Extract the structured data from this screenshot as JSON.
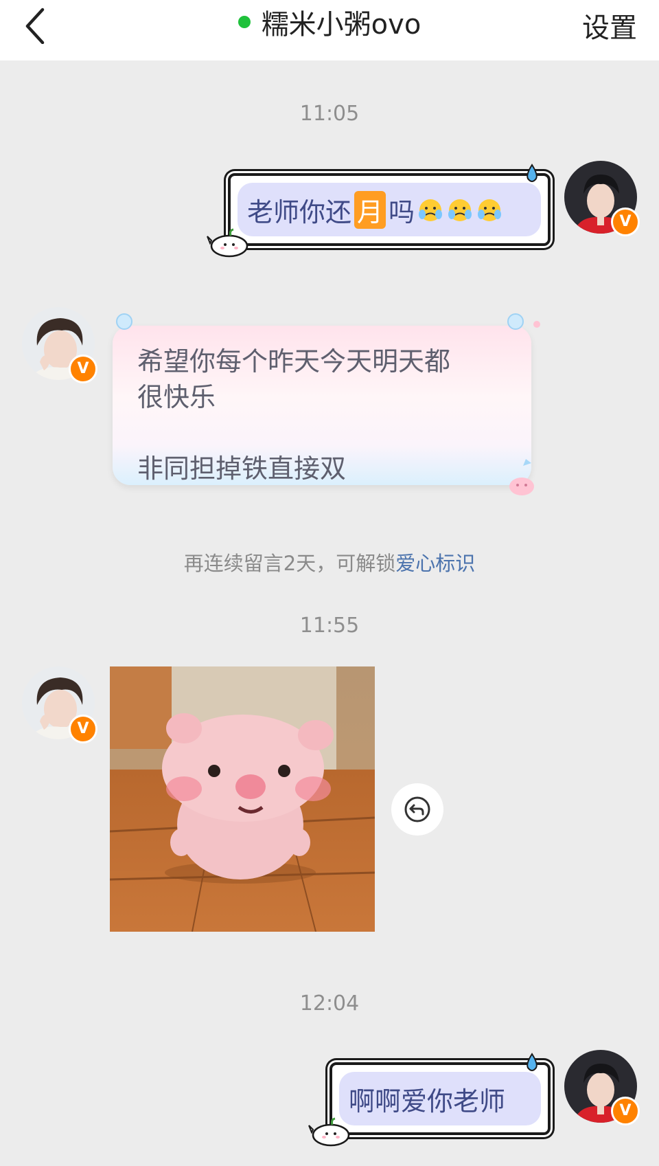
{
  "header": {
    "title": "糯米小粥ovo",
    "settings_label": "设置",
    "online_color": "#1fc13b"
  },
  "messages": {
    "time1": "11:05",
    "msg1": {
      "text_before": "老师你还",
      "highlight": "月",
      "text_after": "吗",
      "emoji": "crying-face-icon",
      "emoji_count": 3
    },
    "msg2": {
      "line1": "希望你每个昨天今天明天都",
      "line2": "很快乐",
      "line3": "非同担掉铁直接双"
    },
    "notice": {
      "prefix": "再连续留言2天，可解锁",
      "link": "爱心标识"
    },
    "time2": "11:55",
    "msg3": {
      "image": "pink-plush-pig-photo"
    },
    "time3": "12:04",
    "msg4": {
      "text": "啊啊爱你老师"
    }
  },
  "badge": {
    "label": "V",
    "color": "#ff8200"
  }
}
